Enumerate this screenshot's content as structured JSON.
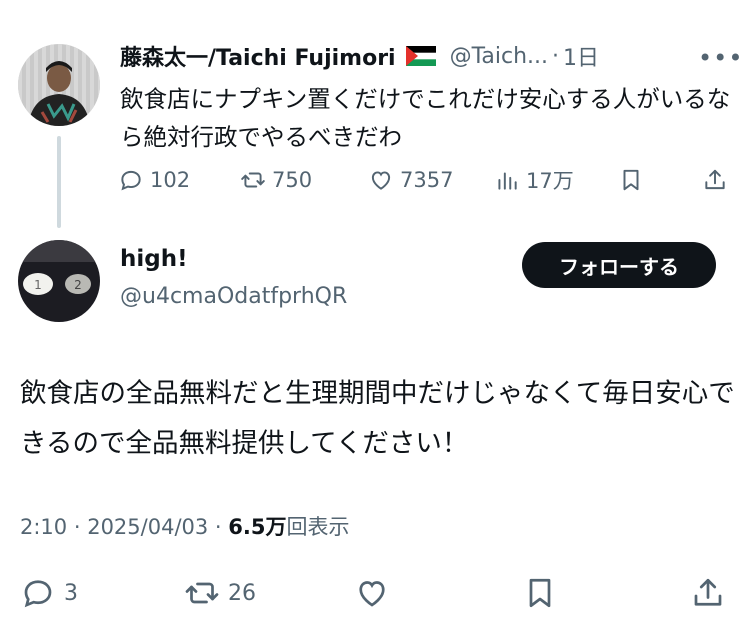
{
  "reply_to": {
    "author_name": "藤森太一/Taichi Fujimori",
    "handle": "@Taich...",
    "dot": "·",
    "time": "1日",
    "text": "飲食店にナプキン置くだけでこれだけ安心する人がいるなら絶対行政でやるべきだわ",
    "flag_icon": "palestine-flag-icon",
    "actions": {
      "replies": "102",
      "reposts": "750",
      "likes": "7357",
      "views": "17万"
    }
  },
  "tweet": {
    "author_name": "high!",
    "handle": "@u4cmaOdatfprhQR",
    "follow_label": "フォローする",
    "text": "飲食店の全品無料だと生理期間中だけじゃなくて毎日安心できるので全品無料提供してください！",
    "meta": {
      "time": "2:10",
      "sep1": " · ",
      "date": "2025/04/03",
      "sep2": " · ",
      "views": "6.5万",
      "views_label": "回表示"
    },
    "actions": {
      "replies": "3",
      "reposts": "26"
    }
  },
  "colors": {
    "text": "#0f1419",
    "secondary": "#536471",
    "thread_line": "#cfd9de",
    "button_bg": "#0f1419"
  }
}
